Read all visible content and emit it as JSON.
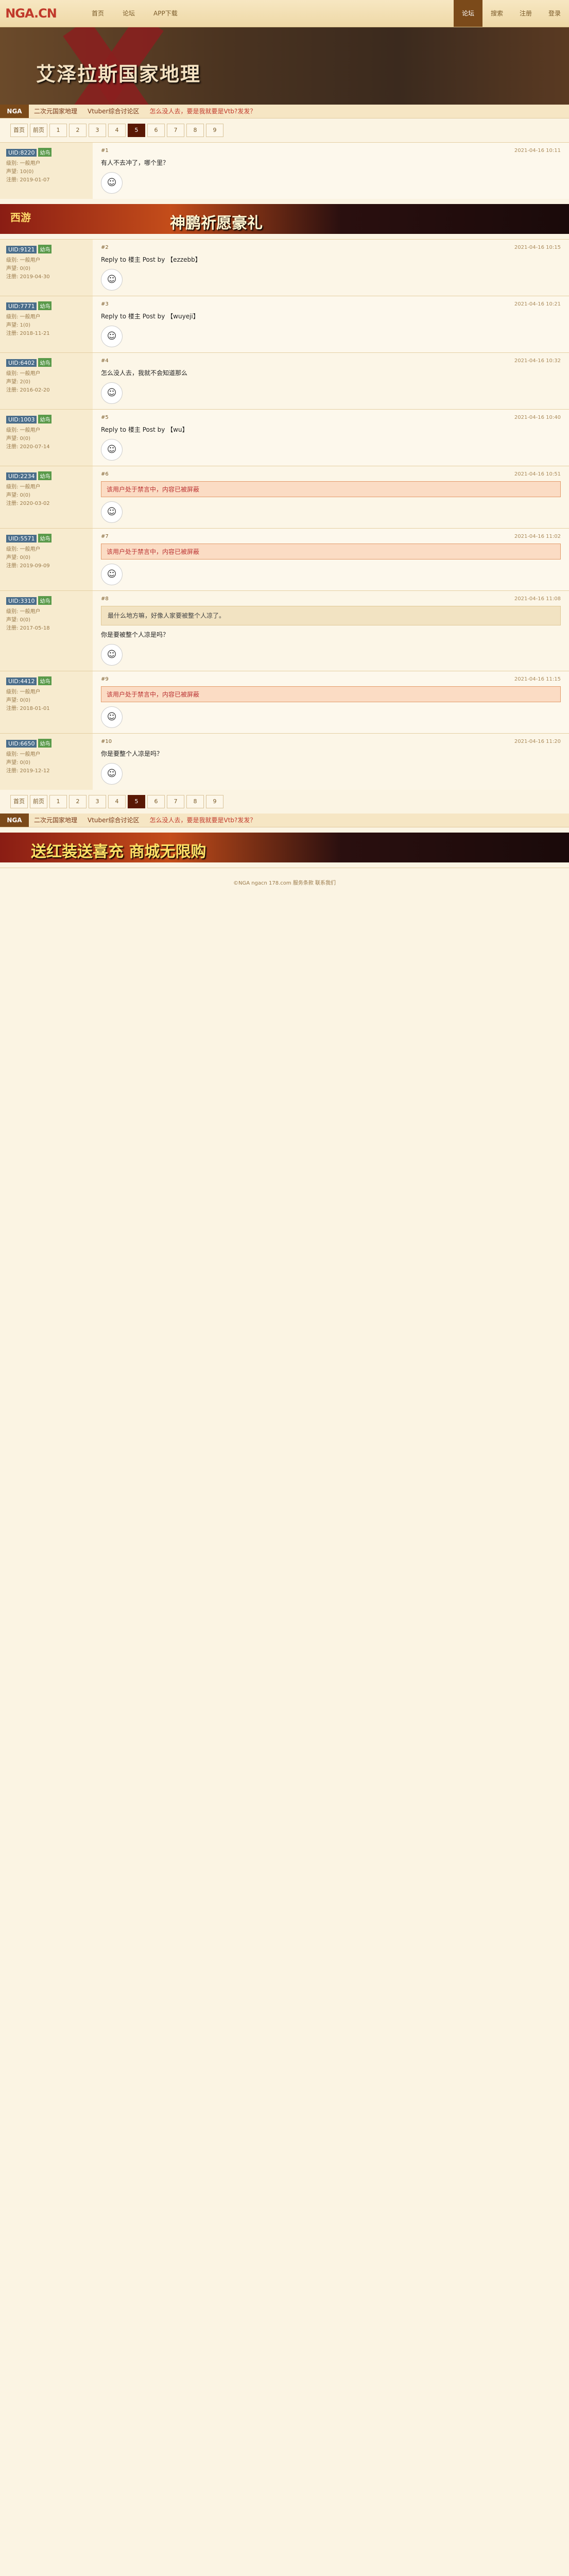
{
  "topbar": {
    "logo": "NGA.CN",
    "nav": [
      "首页",
      "论坛",
      "APP下载"
    ],
    "right": [
      "论坛",
      "搜索",
      "注册",
      "登录"
    ]
  },
  "banner": {
    "title": "艾泽拉斯国家地理"
  },
  "subnav": {
    "home": "NGA",
    "items": [
      "二次元国家地理",
      "Vtuber综合讨论区",
      "怎么没人去，要是我就要是Vtb?发发？"
    ]
  },
  "pager": {
    "first": "首页",
    "prev": "前页",
    "pages": [
      "1",
      "2",
      "3",
      "4",
      "5",
      "6",
      "7",
      "8",
      "9"
    ],
    "current": "5"
  },
  "posts": [
    {
      "name": "UID:8220",
      "level": "幼鸟",
      "stats": [
        "级别: 一般用户",
        "声望: 10(0)",
        "注册: 2019-01-07"
      ],
      "time": "2021-04-16 10:11",
      "floor": "#1",
      "text": "有人不去冲了，哪个里？",
      "quote": "",
      "alert": ""
    },
    {
      "name": "UID:9121",
      "level": "幼鸟",
      "stats": [
        "级别: 一般用户",
        "声望: 0(0)",
        "注册: 2019-04-30"
      ],
      "time": "2021-04-16 10:15",
      "floor": "#2",
      "text": "Reply to 楼主 Post by 【ezzebb】",
      "quote": "",
      "alert": ""
    },
    {
      "name": "UID:7771",
      "level": "幼鸟",
      "stats": [
        "级别: 一般用户",
        "声望: 1(0)",
        "注册: 2018-11-21"
      ],
      "time": "2021-04-16 10:21",
      "floor": "#3",
      "text": "Reply to 楼主 Post by 【wuyeji】",
      "quote": "",
      "alert": ""
    },
    {
      "name": "UID:6402",
      "level": "幼鸟",
      "stats": [
        "级别: 一般用户",
        "声望: 2(0)",
        "注册: 2016-02-20"
      ],
      "time": "2021-04-16 10:32",
      "floor": "#4",
      "text": "怎么没人去，我就不会知道那么",
      "quote": "",
      "alert": ""
    },
    {
      "name": "UID:1003",
      "level": "幼鸟",
      "stats": [
        "级别: 一般用户",
        "声望: 0(0)",
        "注册: 2020-07-14"
      ],
      "time": "2021-04-16 10:40",
      "floor": "#5",
      "text": "Reply to 楼主 Post by 【wu】",
      "quote": "",
      "alert": ""
    },
    {
      "name": "UID:2234",
      "level": "幼鸟",
      "stats": [
        "级别: 一般用户",
        "声望: 0(0)",
        "注册: 2020-03-02"
      ],
      "time": "2021-04-16 10:51",
      "floor": "#6",
      "text": "",
      "quote": "",
      "alert": "该用户处于禁言中，内容已被屏蔽"
    },
    {
      "name": "UID:5571",
      "level": "幼鸟",
      "stats": [
        "级别: 一般用户",
        "声望: 0(0)",
        "注册: 2019-09-09"
      ],
      "time": "2021-04-16 11:02",
      "floor": "#7",
      "text": "",
      "quote": "",
      "alert": "该用户处于禁言中，内容已被屏蔽"
    },
    {
      "name": "UID:3310",
      "level": "幼鸟",
      "stats": [
        "级别: 一般用户",
        "声望: 0(0)",
        "注册: 2017-05-18"
      ],
      "time": "2021-04-16 11:08",
      "floor": "#8",
      "text": "你是要被整个人凉是吗？",
      "quote": "最什么地方嘛，好像人家要被整个人凉了。",
      "alert": ""
    },
    {
      "name": "UID:4412",
      "level": "幼鸟",
      "stats": [
        "级别: 一般用户",
        "声望: 0(0)",
        "注册: 2018-01-01"
      ],
      "time": "2021-04-16 11:15",
      "floor": "#9",
      "text": "",
      "quote": "",
      "alert": "该用户处于禁言中，内容已被屏蔽"
    },
    {
      "name": "UID:6650",
      "level": "幼鸟",
      "stats": [
        "级别: 一般用户",
        "声望: 0(0)",
        "注册: 2019-12-12"
      ],
      "time": "2021-04-16 11:20",
      "floor": "#10",
      "text": "你是要整个人凉是吗？",
      "quote": "",
      "alert": ""
    }
  ],
  "ads": [
    {
      "logo": "西游",
      "text": "神鹏祈愿豪礼"
    },
    {
      "logo": "",
      "text": "送红装送喜充 商城无限购"
    }
  ],
  "footer": {
    "text": "©NGA ngacn 178.com 服务条款 联系我们"
  }
}
